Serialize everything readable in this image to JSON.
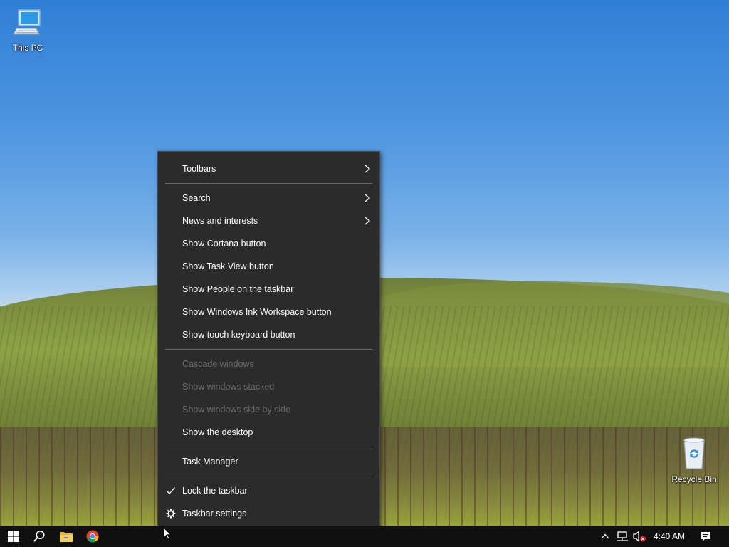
{
  "desktop": {
    "icons": [
      {
        "label": "This PC"
      },
      {
        "label": "Recycle Bin"
      }
    ]
  },
  "context_menu": {
    "items": [
      {
        "label": "Toolbars",
        "submenu": true
      },
      {
        "label": "Search",
        "submenu": true
      },
      {
        "label": "News and interests",
        "submenu": true
      },
      {
        "label": "Show Cortana button"
      },
      {
        "label": "Show Task View button"
      },
      {
        "label": "Show People on the taskbar"
      },
      {
        "label": "Show Windows Ink Workspace button"
      },
      {
        "label": "Show touch keyboard button"
      },
      {
        "label": "Cascade windows",
        "disabled": true
      },
      {
        "label": "Show windows stacked",
        "disabled": true
      },
      {
        "label": "Show windows side by side",
        "disabled": true
      },
      {
        "label": "Show the desktop"
      },
      {
        "label": "Task Manager"
      },
      {
        "label": "Lock the taskbar",
        "checked": true,
        "icon": "checkmark-icon"
      },
      {
        "label": "Taskbar settings",
        "icon": "gear-icon"
      }
    ]
  },
  "taskbar": {
    "pinned": [
      "start-icon",
      "search-icon",
      "file-explorer-icon",
      "chrome-icon"
    ],
    "tray": [
      "chevron-up-icon",
      "network-icon",
      "volume-muted-icon"
    ],
    "clock": "4:40 AM",
    "notifications": "action-center-icon"
  },
  "colors": {
    "menu_bg": "#2b2b2b",
    "menu_disabled_text": "#6d6d6d",
    "taskbar_bg": "#101010"
  }
}
